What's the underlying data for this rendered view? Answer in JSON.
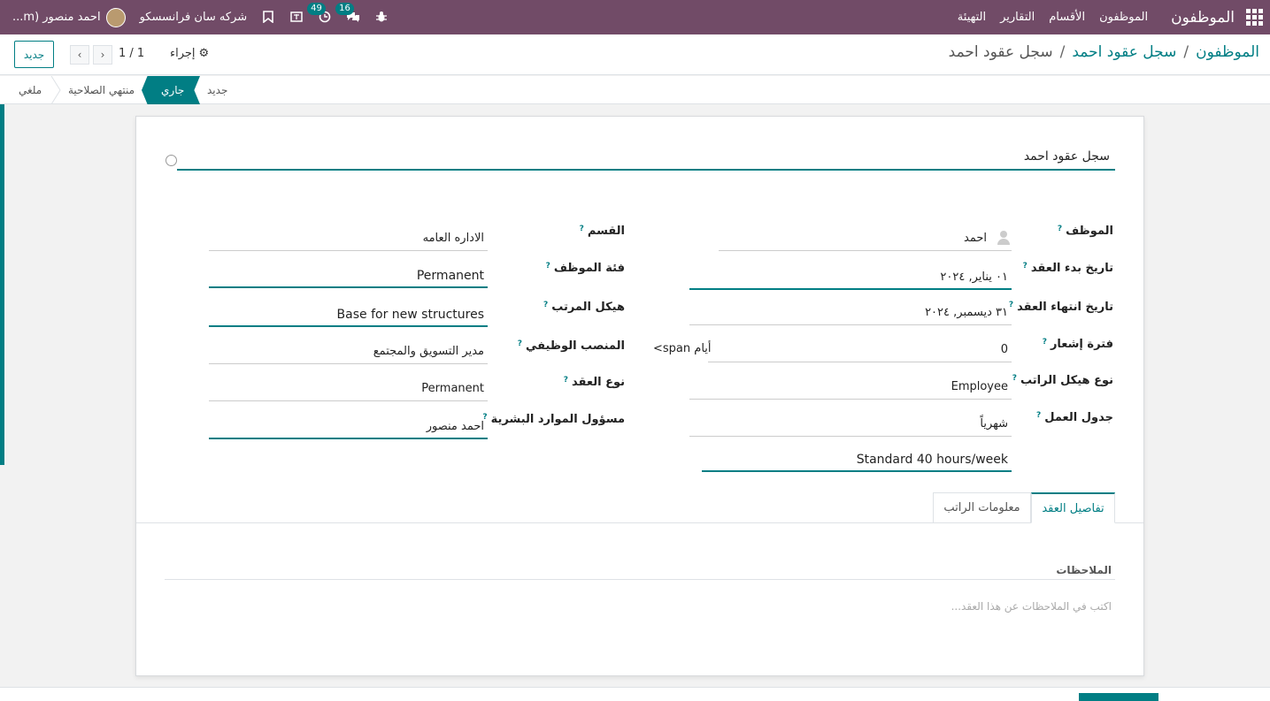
{
  "topbar": {
    "brand": "الموظفون",
    "menu": [
      "الموظفون",
      "الأقسام",
      "التقارير",
      "التهيئة"
    ],
    "company": "شركه سان فرانسسكو",
    "user": "احمد منصور (m...",
    "badge_activity": "49",
    "badge_messages": "16"
  },
  "breadcrumb": {
    "root": "الموظفون",
    "parent": "سجل عقود احمد",
    "current": "سجل عقود احمد"
  },
  "control": {
    "new_label": "جديد",
    "pager": "1 / 1",
    "action_label": "إجراء"
  },
  "status_stages": [
    "جديد",
    "جاري",
    "منتهي الصلاحية",
    "ملغي"
  ],
  "form": {
    "title": "سجل عقود احمد",
    "right": {
      "employee_label": "الموظف",
      "employee_value": "احمد",
      "start_label": "تاريخ بدء العقد",
      "start_value": "٠١ يناير, ٢٠٢٤",
      "end_label": "تاريخ انتهاء العقد",
      "end_value": "٣١ ديسمبر, ٢٠٢٤",
      "notice_label": "فترة إشعار",
      "notice_value": "0",
      "notice_unit": "أيام span>",
      "structure_type_label": "نوع هيكل الراتب",
      "structure_type_value": "Employee",
      "schedule_label": "جدول العمل",
      "schedule_value": "شهرياً",
      "calendar_value": "Standard 40 hours/week"
    },
    "left": {
      "department_label": "القسم",
      "department_value": "الاداره العامه",
      "category_label": "فئة الموظف",
      "category_value": "Permanent",
      "salary_structure_label": "هيكل المرتب",
      "salary_structure_value": "Base for new structures",
      "job_label": "المنصب الوظيفي",
      "job_value": "مدير التسويق والمجتمع",
      "contract_type_label": "نوع العقد",
      "contract_type_value": "Permanent",
      "hr_label": "مسؤول الموارد البشرية",
      "hr_value": "احمد منصور"
    },
    "tabs": [
      "تفاصيل العقد",
      "معلومات الراتب"
    ],
    "notes_label": "الملاحظات",
    "notes_placeholder": "اكتب في الملاحظات عن هذا العقد..."
  },
  "colors": {
    "navbar": "#714B67",
    "accent": "#017e84"
  }
}
